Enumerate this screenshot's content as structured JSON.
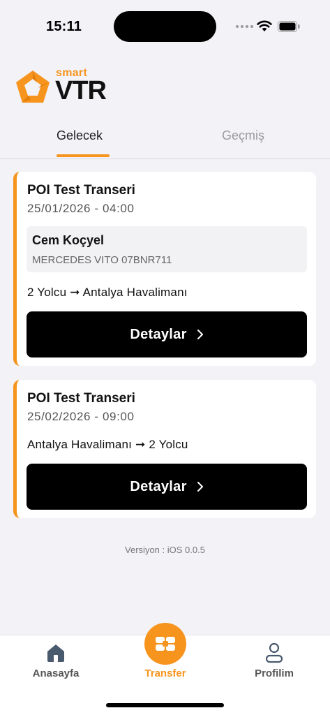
{
  "status_bar": {
    "time": "15:11"
  },
  "logo": {
    "smart": "smart",
    "brand": "VTR"
  },
  "tabs": [
    {
      "label": "Gelecek",
      "active": true
    },
    {
      "label": "Geçmiş",
      "active": false
    }
  ],
  "transfers": [
    {
      "title": "POI Test Transeri",
      "date": "25/01/2026 - 04:00",
      "driver": "Cem Koçyel",
      "vehicle": "MERCEDES VITO 07BNR711",
      "route": "2 Yolcu ➞ Antalya Havalimanı",
      "button": "Detaylar"
    },
    {
      "title": "POI Test Transeri",
      "date": "25/02/2026 - 09:00",
      "route": "Antalya Havalimanı ➞ 2 Yolcu",
      "button": "Detaylar"
    }
  ],
  "version": "Versiyon : iOS 0.0.5",
  "bottom_nav": [
    {
      "label": "Anasayfa",
      "icon": "home-icon"
    },
    {
      "label": "Transfer",
      "icon": "transfer-icon",
      "active": true
    },
    {
      "label": "Profilim",
      "icon": "profile-icon"
    }
  ],
  "colors": {
    "accent": "#f7941d",
    "background": "#f2f2f7",
    "button": "#000000"
  }
}
